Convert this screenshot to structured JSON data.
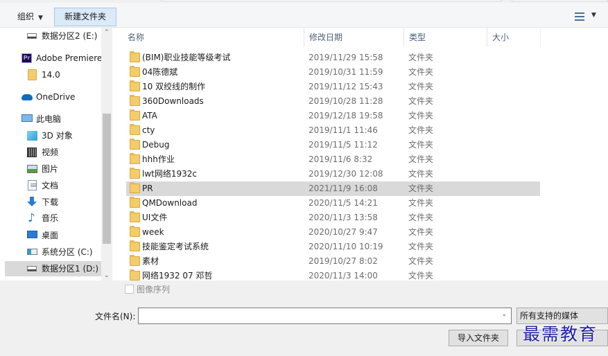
{
  "toolbar": {
    "organize_label": "组织",
    "new_folder_label": "新建文件夹"
  },
  "nav": {
    "items": [
      {
        "label": "数据分区2 (E:)",
        "icon": "drive-icon"
      },
      {
        "label": "Adobe Premiere",
        "icon": "premiere-icon"
      },
      {
        "label": "14.0",
        "icon": "folder-icon"
      },
      {
        "label": "OneDrive",
        "icon": "onedrive-icon"
      },
      {
        "label": "此电脑",
        "icon": "pc-icon"
      },
      {
        "label": "3D 对象",
        "icon": "3d-objects-icon"
      },
      {
        "label": "视频",
        "icon": "video-icon"
      },
      {
        "label": "图片",
        "icon": "pictures-icon"
      },
      {
        "label": "文档",
        "icon": "documents-icon"
      },
      {
        "label": "下载",
        "icon": "download-icon"
      },
      {
        "label": "音乐",
        "icon": "music-icon"
      },
      {
        "label": "桌面",
        "icon": "desktop-icon"
      },
      {
        "label": "系统分区 (C:)",
        "icon": "system-drive-icon"
      },
      {
        "label": "数据分区1 (D:)",
        "icon": "drive-icon"
      }
    ]
  },
  "columns": {
    "name": "名称",
    "date": "修改日期",
    "type": "类型",
    "size": "大小"
  },
  "files": [
    {
      "name": "(BIM)职业技能等级考试",
      "date": "2019/11/29 15:58",
      "type": "文件夹",
      "size": ""
    },
    {
      "name": "04陈德斌",
      "date": "2019/10/31 11:59",
      "type": "文件夹",
      "size": ""
    },
    {
      "name": "10 双绞线的制作",
      "date": "2019/11/12 15:43",
      "type": "文件夹",
      "size": ""
    },
    {
      "name": "360Downloads",
      "date": "2019/10/28 11:28",
      "type": "文件夹",
      "size": ""
    },
    {
      "name": "ATA",
      "date": "2019/12/18 19:58",
      "type": "文件夹",
      "size": ""
    },
    {
      "name": "cty",
      "date": "2019/11/1 11:46",
      "type": "文件夹",
      "size": ""
    },
    {
      "name": "Debug",
      "date": "2019/11/5 11:12",
      "type": "文件夹",
      "size": ""
    },
    {
      "name": "hhh作业",
      "date": "2019/11/6 8:32",
      "type": "文件夹",
      "size": ""
    },
    {
      "name": "lwt网络1932c",
      "date": "2019/12/30 12:08",
      "type": "文件夹",
      "size": ""
    },
    {
      "name": "PR",
      "date": "2021/11/9 16:08",
      "type": "文件夹",
      "size": ""
    },
    {
      "name": "QMDownload",
      "date": "2020/11/5 14:21",
      "type": "文件夹",
      "size": ""
    },
    {
      "name": "UI文件",
      "date": "2020/11/3 13:58",
      "type": "文件夹",
      "size": ""
    },
    {
      "name": "week",
      "date": "2020/10/27 9:47",
      "type": "文件夹",
      "size": ""
    },
    {
      "name": "技能鉴定考试系统",
      "date": "2020/11/10 10:19",
      "type": "文件夹",
      "size": ""
    },
    {
      "name": "素材",
      "date": "2019/10/27 8:02",
      "type": "文件夹",
      "size": ""
    },
    {
      "name": "网络1932 07 邓哲",
      "date": "2020/11/3 14:00",
      "type": "文件夹",
      "size": ""
    }
  ],
  "selected_file": "PR",
  "bottom": {
    "preview_label": "图像序列",
    "filename_label": "文件名(N):",
    "filename_value": "",
    "filter_value": "所有支持的媒体",
    "import_label": "导入文件夹",
    "watermark": "最需教育"
  }
}
